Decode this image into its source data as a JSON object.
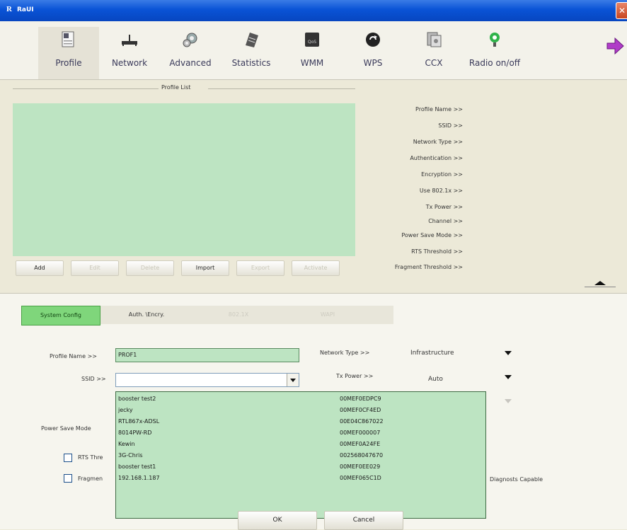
{
  "window": {
    "title": "RaUI",
    "logo_letter": "R"
  },
  "toolbar": [
    {
      "label": "Profile",
      "icon": "profile-icon",
      "active": true
    },
    {
      "label": "Network",
      "icon": "network-icon"
    },
    {
      "label": "Advanced",
      "icon": "advanced-icon"
    },
    {
      "label": "Statistics",
      "icon": "statistics-icon"
    },
    {
      "label": "WMM",
      "icon": "wmm-icon"
    },
    {
      "label": "WPS",
      "icon": "wps-icon"
    },
    {
      "label": "CCX",
      "icon": "ccx-icon"
    },
    {
      "label": "Radio on/off",
      "icon": "radio-icon"
    }
  ],
  "profile_list": {
    "title": "Profile List",
    "buttons": {
      "add": "Add",
      "edit": "Edit",
      "delete": "Delete",
      "import": "Import",
      "export": "Export",
      "activate": "Activate"
    }
  },
  "profile_info": {
    "profile_name": "Profile Name >>",
    "ssid": "SSID >>",
    "network_type": "Network Type >>",
    "authentication": "Authentication >>",
    "encryption": "Encryption >>",
    "use_8021x": "Use 802.1x >>",
    "tx_power": "Tx Power >>",
    "channel": "Channel >>",
    "power_save_mode": "Power Save Mode >>",
    "rts_threshold": "RTS Threshold >>",
    "fragment_threshold": "Fragment Threshold >>"
  },
  "tabs": {
    "system_config": "System Config",
    "auth_encry": "Auth. \\Encry.",
    "tab_8021x": "802.1X",
    "wapi": "WAPI"
  },
  "form": {
    "profile_name_label": "Profile Name >>",
    "profile_name_value": "PROF1",
    "ssid_label": "SSID >>",
    "ssid_value": "",
    "network_type_label": "Network Type >>",
    "network_type_value": "Infrastructure",
    "tx_power_label": "Tx Power >>",
    "tx_power_value": "Auto",
    "power_save_label": "Power Save Mode",
    "rts_label": "RTS Thre",
    "fragment_label": "Fragmen",
    "diagnosis_label": "Diagnosts Capable"
  },
  "ssid_dropdown": [
    {
      "name": "booster test2",
      "mac": "00MEF0EDPC9"
    },
    {
      "name": "jecky",
      "mac": "00MEF0CF4ED"
    },
    {
      "name": "RTL867x-ADSL",
      "mac": "00E04C867022"
    },
    {
      "name": "8014PW-RD",
      "mac": "00MEF000007"
    },
    {
      "name": "Kewin",
      "mac": "00MEF0A24FE"
    },
    {
      "name": "3G-Chris",
      "mac": "002568047670"
    },
    {
      "name": "booster test1",
      "mac": "00MEF0EE029"
    },
    {
      "name": "192.168.1.187",
      "mac": "00MEF065C1D"
    }
  ],
  "actions": {
    "ok": "OK",
    "cancel": "Cancel"
  }
}
